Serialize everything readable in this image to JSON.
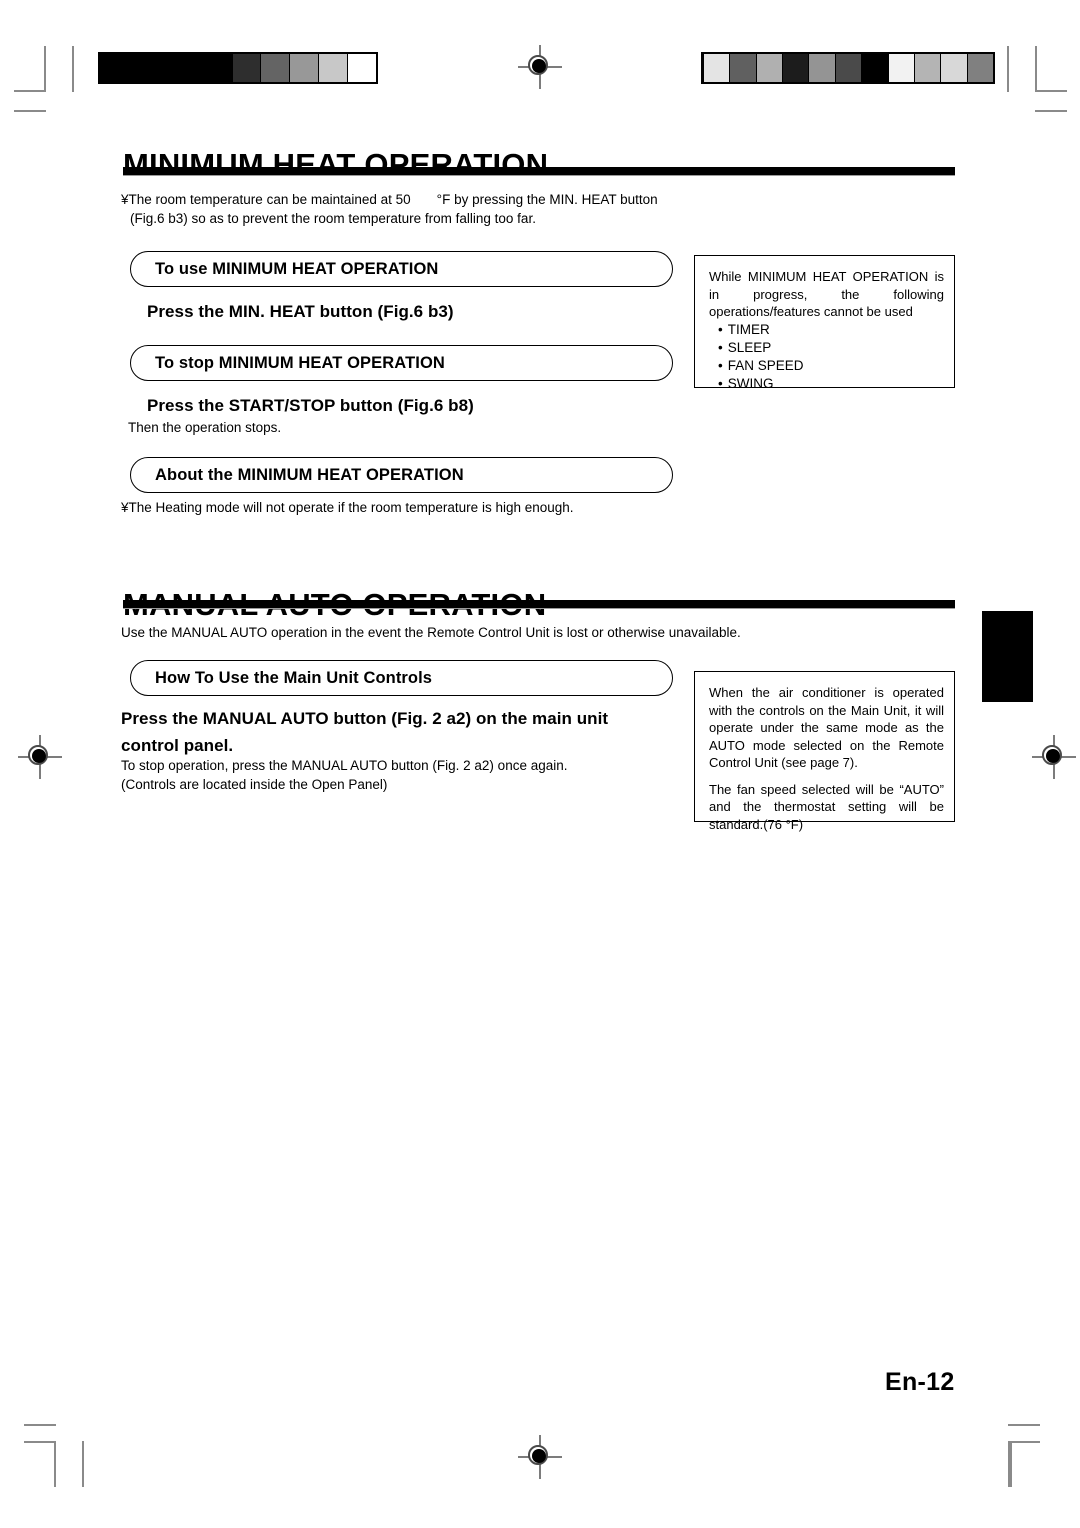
{
  "page": {
    "number_label": "En-12",
    "background": "#ffffff",
    "ink": "#000000"
  },
  "sections": [
    {
      "id": "minimum-heat-operation",
      "title": "MINIMUM HEAT OPERATION",
      "intro_line1_prefix": "¥The room temperature can be maintained at 50",
      "intro_line1_suffix": "°F by pressing the MIN. HEAT button",
      "intro_line2": "(Fig.6 b3) so as to prevent the room temperature from falling too far.",
      "blocks": [
        {
          "box_label": "To use MINIMUM HEAT OPERATION",
          "heading": "Press the MIN. HEAT button (Fig.6 b3)",
          "note": ""
        },
        {
          "box_label": "To stop MINIMUM HEAT OPERATION",
          "heading": "Press the START/STOP button (Fig.6 b8)",
          "note": "Then the operation stops."
        },
        {
          "box_label": "About the MINIMUM HEAT OPERATION",
          "heading": "",
          "note": "¥The Heating mode will not operate if the room temperature is high enough."
        }
      ],
      "side_note": {
        "paragraph": "While MINIMUM HEAT OPERATION is in progress, the following operations/features cannot be used",
        "bullets": [
          "TIMER",
          "SLEEP",
          "FAN SPEED",
          "SWING"
        ]
      }
    },
    {
      "id": "manual-auto-operation",
      "title": "MANUAL AUTO OPERATION",
      "intro": "Use the MANUAL AUTO operation in the event the Remote Control Unit is lost or otherwise unavailable.",
      "box_label": "How To Use the Main Unit Controls",
      "heading_line1": "Press the MANUAL AUTO button  (Fig. 2 a2) on the main unit",
      "heading_line2": "control panel.",
      "note_line1": "To stop operation, press the MANUAL AUTO button (Fig. 2 a2) once again.",
      "note_line2": "(Controls are located inside the Open Panel)",
      "side_note": {
        "paragraph1": "When the air conditioner is operated with the controls on the Main Unit, it will operate under the same mode as the AUTO mode selected on the Remote Control Unit (see page 7).",
        "paragraph2": "The fan speed selected will be  “AUTO” and the thermostat setting will be standard.(76 °F)"
      }
    }
  ],
  "print_marks": {
    "left_calibration_bar": {
      "name": "density-calibration-bar-left",
      "swatches": [
        "#000000",
        "#000000",
        "#2e2e2e",
        "#646464",
        "#989898",
        "#c8c8c8",
        "#ffffff"
      ]
    },
    "right_calibration_bar": {
      "name": "density-calibration-bar-right",
      "swatches": [
        "#e4e4e4",
        "#606060",
        "#b0b0b0",
        "#1c1c1c",
        "#949494",
        "#4a4a4a",
        "#000000",
        "#f2f2f2",
        "#b4b4b4",
        "#d8d8d8",
        "#808080"
      ]
    },
    "registration_marks": 5,
    "crop_marks": 4,
    "thumb_tab": true
  }
}
